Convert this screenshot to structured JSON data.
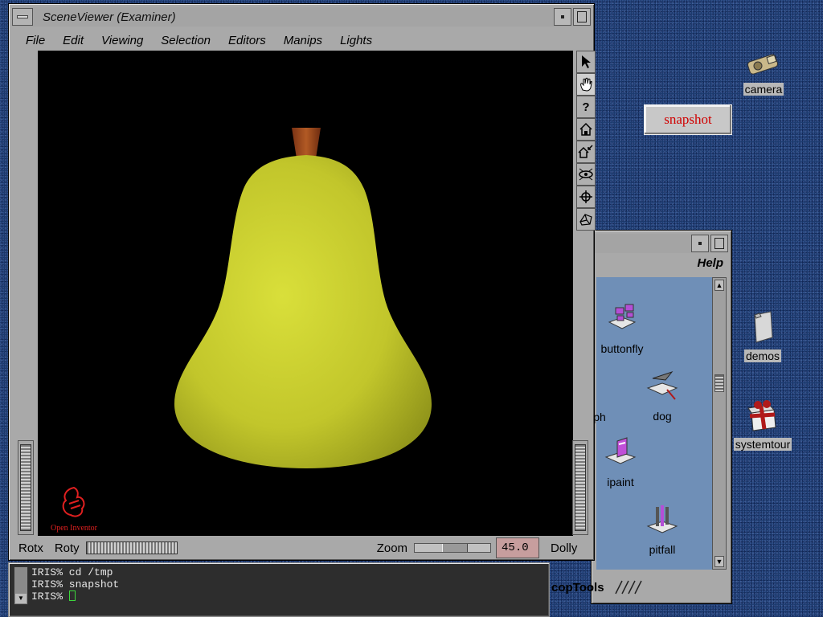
{
  "scene_viewer": {
    "title": "SceneViewer (Examiner)",
    "menu": [
      "File",
      "Edit",
      "Viewing",
      "Selection",
      "Editors",
      "Manips",
      "Lights"
    ],
    "tools": [
      "arrow-pointer-icon",
      "hand-icon",
      "question-icon",
      "home-icon",
      "set-home-icon",
      "view-all-icon",
      "seek-icon",
      "projection-icon"
    ],
    "logo_text": "Open Inventor",
    "bottom": {
      "rotx": "Rotx",
      "roty": "Roty",
      "zoom": "Zoom",
      "zoom_value": "45.0",
      "dolly": "Dolly"
    }
  },
  "terminal": {
    "lines": [
      "IRIS% cd /tmp",
      "IRIS% snapshot",
      "IRIS% "
    ]
  },
  "desktop_tools": {
    "help": "Help",
    "footer": "copTools",
    "items": [
      {
        "label": "buttonfly"
      },
      {
        "label": "dog"
      },
      {
        "label": "ph"
      },
      {
        "label": "ipaint"
      },
      {
        "label": "pitfall"
      }
    ]
  },
  "snapshot_button": "snapshot",
  "desktop_icons": [
    {
      "label": "camera"
    },
    {
      "label": "demos"
    },
    {
      "label": "systemtour"
    }
  ],
  "colors": {
    "desktop": "#1c3b6e",
    "pear": "#c6cc2a",
    "stem": "#a0461e",
    "snapshot_text": "#d00000",
    "zoom_field": "#c79e9e"
  }
}
